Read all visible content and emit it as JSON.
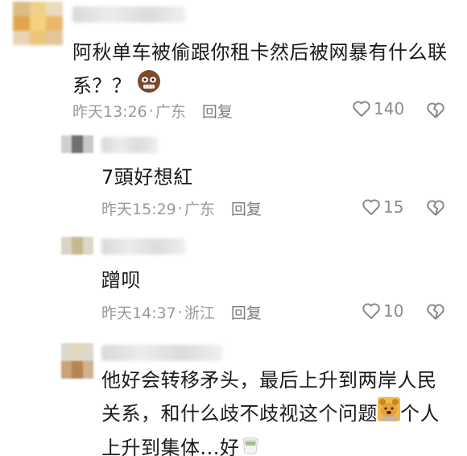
{
  "comments": [
    {
      "text": "阿秋单车被偷跟你租卡然后被网暴有什么联系？？",
      "time": "昨天13:26",
      "location": "广东",
      "reply_label": "回复",
      "likes": "140",
      "emoji": "face-emoji"
    },
    {
      "text": "7頭好想紅",
      "time": "昨天15:29",
      "location": "广东",
      "reply_label": "回复",
      "likes": "15"
    },
    {
      "text": "蹭呗",
      "time": "昨天14:37",
      "location": "浙江",
      "reply_label": "回复",
      "likes": "10"
    },
    {
      "text_line1": "他好会转移矛头，最后上升到两岸人民",
      "text_line2a": "关系，和什么歧不歧视这个问题",
      "text_line2b": "个人",
      "text_line3": "上升到集体...好",
      "emoji_a": "bear-emoji",
      "emoji_b": "tea-cup-emoji"
    }
  ],
  "separator": "·"
}
